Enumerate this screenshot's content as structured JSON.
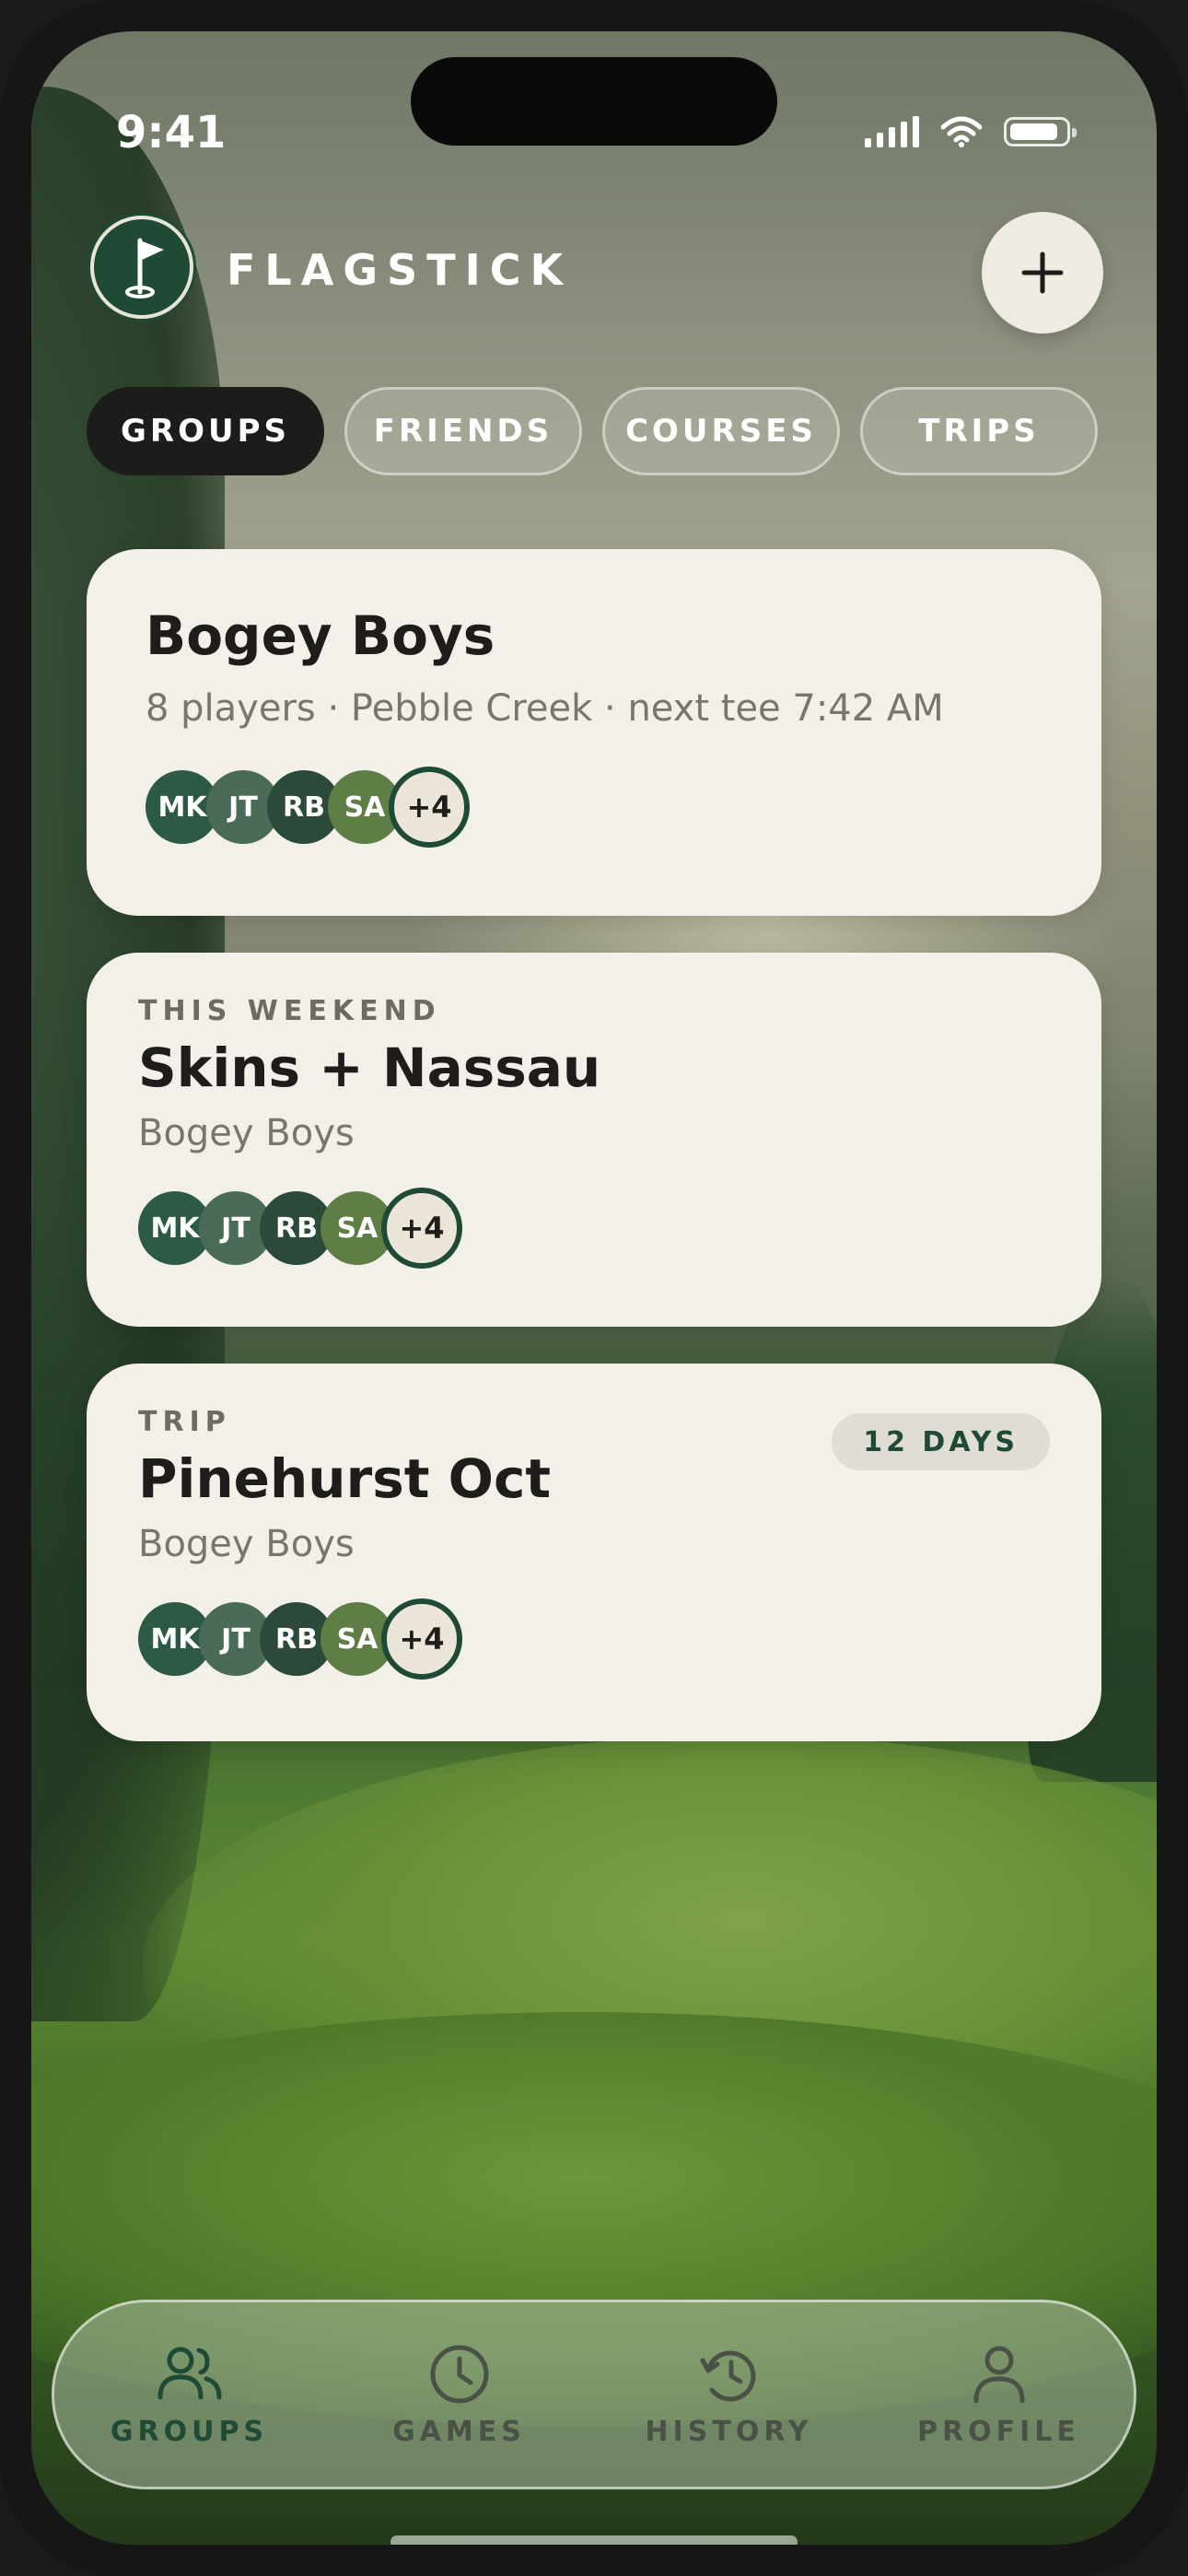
{
  "status_bar": {
    "time": "9:41"
  },
  "header": {
    "brand": "FLAGSTICK",
    "add_label": "+"
  },
  "tabs": [
    {
      "label": "GROUPS",
      "active": true
    },
    {
      "label": "FRIENDS",
      "active": false
    },
    {
      "label": "COURSES",
      "active": false
    },
    {
      "label": "TRIPS",
      "active": false
    }
  ],
  "cards": [
    {
      "title": "Bogey Boys",
      "subtitle": "8 players · Pebble Creek · next tee 7:42 AM",
      "avatars": [
        "MK",
        "JT",
        "RB",
        "SA"
      ],
      "more": "+4"
    },
    {
      "eyebrow": "THIS WEEKEND",
      "title": "Skins + Nassau",
      "subtitle": "Bogey Boys",
      "avatars": [
        "MK",
        "JT",
        "RB",
        "SA"
      ],
      "more": "+4"
    },
    {
      "eyebrow": "TRIP",
      "title": "Pinehurst Oct",
      "subtitle": "Bogey Boys",
      "badge": "12 DAYS",
      "avatars": [
        "MK",
        "JT",
        "RB",
        "SA"
      ],
      "more": "+4"
    }
  ],
  "avatar_colors": [
    "#2c5a44",
    "#4a6b58",
    "#2b4a3a",
    "#5f7e45"
  ],
  "bottom_nav": [
    {
      "label": "GROUPS",
      "icon": "people-icon",
      "active": true
    },
    {
      "label": "GAMES",
      "icon": "clock-icon",
      "active": false
    },
    {
      "label": "HISTORY",
      "icon": "history-icon",
      "active": false
    },
    {
      "label": "PROFILE",
      "icon": "person-icon",
      "active": false
    }
  ],
  "colors": {
    "brand_green": "#1f4a36",
    "card_bg": "#f3f0ea",
    "active_tab": "#1c1c1a"
  }
}
